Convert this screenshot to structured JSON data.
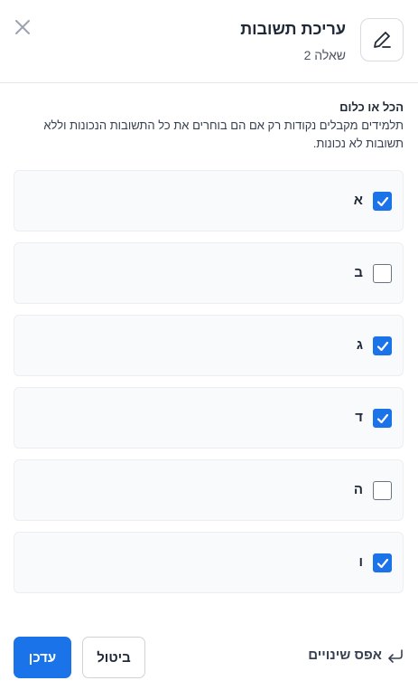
{
  "header": {
    "title": "עריכת תשובות",
    "subtitle": "שאלה 2",
    "close_icon": "close-icon",
    "title_icon": "pencil-icon"
  },
  "section": {
    "title": "הכל או כלום",
    "description": "תלמידים מקבלים נקודות רק אם הם בוחרים את כל התשובות הנכונות וללא תשובות לא נכונות."
  },
  "options": [
    {
      "label": "א",
      "checked": true
    },
    {
      "label": "ב",
      "checked": false
    },
    {
      "label": "ג",
      "checked": true
    },
    {
      "label": "ד",
      "checked": true
    },
    {
      "label": "ה",
      "checked": false
    },
    {
      "label": "ו",
      "checked": true
    }
  ],
  "footer": {
    "reset_label": "אפס שינויים",
    "reset_icon": "reset-arrow-icon",
    "cancel_label": "ביטול",
    "update_label": "עדכן"
  },
  "colors": {
    "accent": "#1a73e8",
    "text": "#1f2937"
  }
}
